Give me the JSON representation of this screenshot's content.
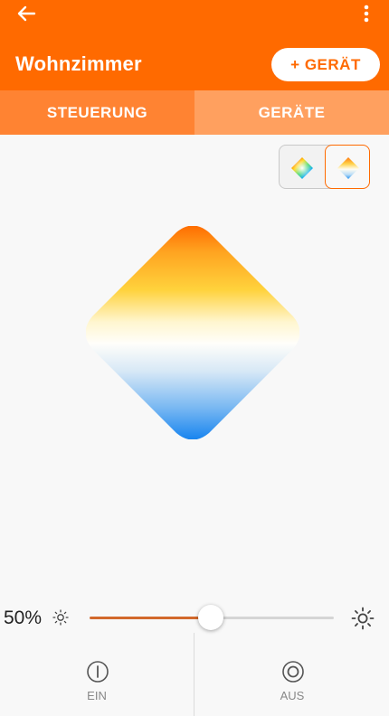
{
  "header": {
    "title": "Wohnzimmer",
    "add_device_label": "+ GERÄT",
    "back_icon": "arrow-left-icon",
    "menu_icon": "more-vert-icon",
    "background_color": "#ff6a00"
  },
  "tabs": [
    {
      "label": "STEUERUNG",
      "active": true
    },
    {
      "label": "GERÄTE",
      "active": false
    }
  ],
  "mode_switch": {
    "options": [
      {
        "icon": "color-diamond-icon",
        "selected": false
      },
      {
        "icon": "white-temperature-diamond-icon",
        "selected": true
      }
    ]
  },
  "color_picker": {
    "mode": "color temperature",
    "gradient_colors": [
      "#ff6a00",
      "#ffce33",
      "#fffdf2",
      "#b8d9f7",
      "#1e8ff0"
    ]
  },
  "brightness": {
    "value_label": "50%",
    "value": 0.5,
    "accent_color": "#d2692c"
  },
  "power": {
    "on_label": "EIN",
    "off_label": "AUS"
  }
}
